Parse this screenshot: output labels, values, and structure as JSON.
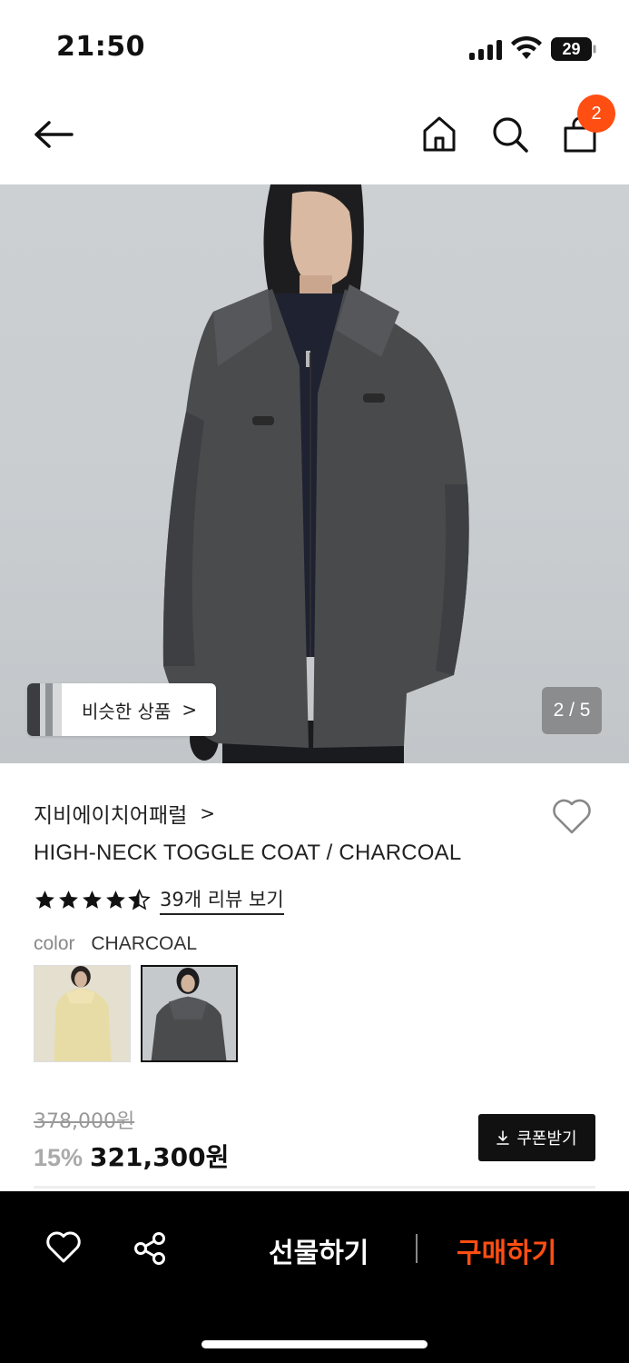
{
  "status_bar": {
    "time": "21:50",
    "battery": "29"
  },
  "nav": {
    "cart_count": "2"
  },
  "gallery": {
    "similar_label": "비슷한 상품",
    "similar_chevron": ">",
    "page_indicator": "2 / 5"
  },
  "product": {
    "brand": "지비에이치어패럴",
    "brand_chevron": ">",
    "name": "HIGH-NECK TOGGLE COAT / CHARCOAL",
    "rating": 4.5,
    "review_link": "39개 리뷰 보기",
    "color_label": "color",
    "color_value": "CHARCOAL",
    "original_price": "378,000원",
    "discount": "15%",
    "sale_price": "321,300원",
    "coupon_label": "쿠폰받기"
  },
  "bottom_bar": {
    "gift_label": "선물하기",
    "buy_label": "구매하기",
    "buy_color": "#ff4e12"
  },
  "icons": [
    "back-arrow-icon",
    "home-icon",
    "search-icon",
    "shopping-bag-icon",
    "heart-icon",
    "share-icon",
    "star-icon",
    "download-icon"
  ]
}
